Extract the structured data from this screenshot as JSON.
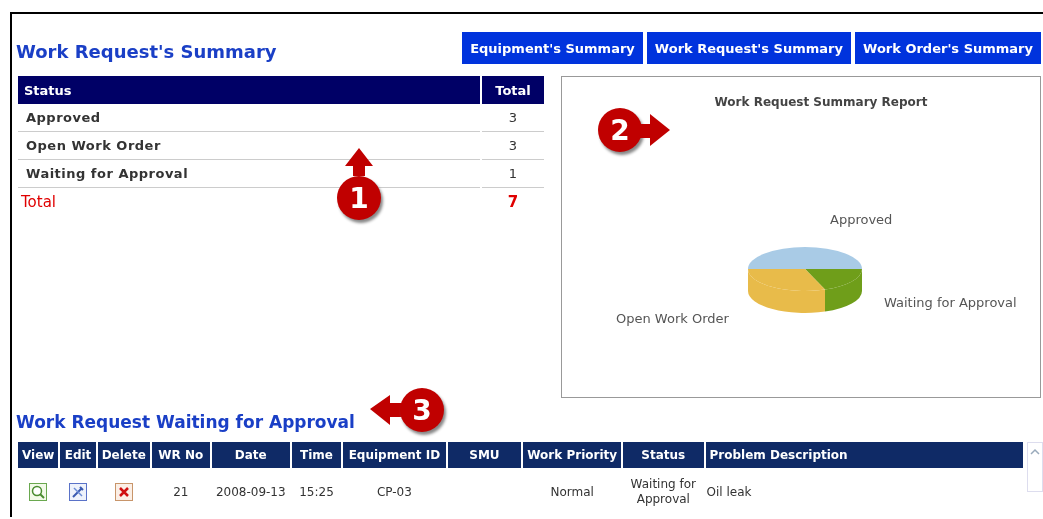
{
  "title": "Work Request's Summary",
  "nav_buttons": [
    "Equipment's Summary",
    "Work Request's Summary",
    "Work Order's Summary"
  ],
  "summary_table": {
    "columns": [
      "Status",
      "Total"
    ],
    "rows": [
      {
        "status": "Approved",
        "total": "3"
      },
      {
        "status": "Open Work Order",
        "total": "3"
      },
      {
        "status": "Waiting for Approval",
        "total": "1"
      }
    ],
    "total": {
      "label": "Total",
      "value": "7"
    }
  },
  "chart": {
    "title": "Work Request Summary Report",
    "slices": [
      {
        "label": "Approved",
        "color": "#a9cbe6"
      },
      {
        "label": "Waiting for Approval",
        "color": "#6f9e1a"
      },
      {
        "label": "Open Work Order",
        "color": "#e8bb4a"
      }
    ]
  },
  "callouts": [
    "1",
    "2",
    "3"
  ],
  "waiting_section": {
    "title": "Work Request Waiting for Approval",
    "columns": [
      "View",
      "Edit",
      "Delete",
      "WR No",
      "Date",
      "Time",
      "Equipment ID",
      "SMU",
      "Work Priority",
      "Status",
      "Problem Description"
    ],
    "rows": [
      {
        "wr_no": "21",
        "date": "2008-09-13",
        "time": "15:25",
        "equipment_id": "CP-03",
        "smu": "",
        "priority": "Normal",
        "status": "Waiting for Approval",
        "description": "Oil leak"
      }
    ]
  }
}
